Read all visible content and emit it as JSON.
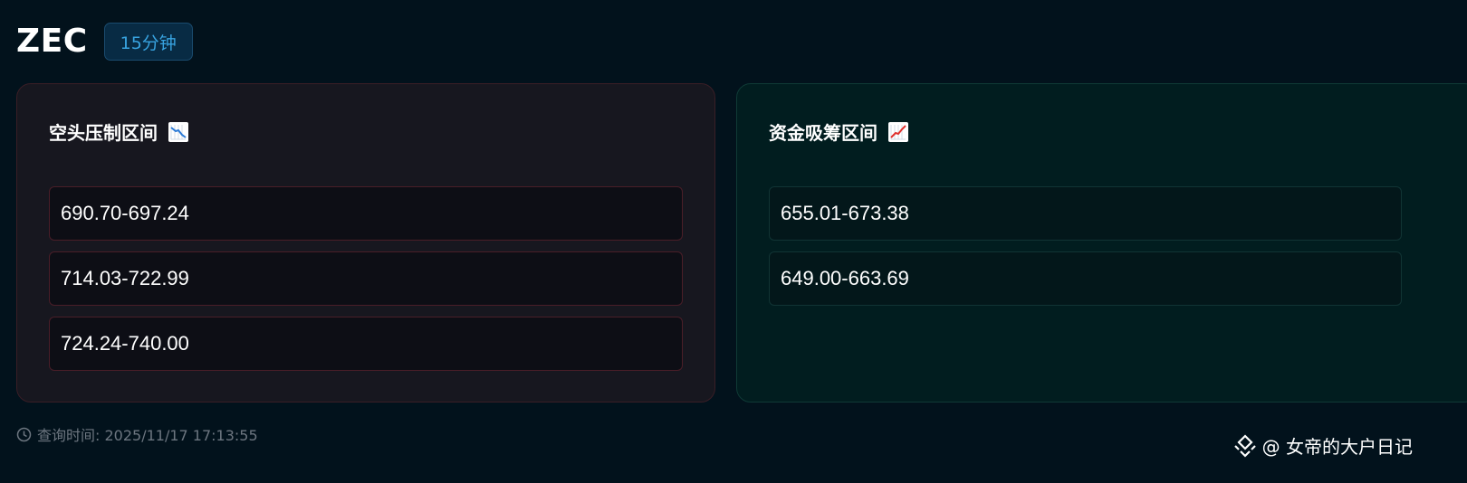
{
  "header": {
    "symbol": "ZEC",
    "timeframe": "15分钟"
  },
  "short_panel": {
    "title": "空头压制区间",
    "icon": "chart-decreasing-icon",
    "ranges": [
      "690.70-697.24",
      "714.03-722.99",
      "724.24-740.00"
    ]
  },
  "long_panel": {
    "title": "资金吸筹区间",
    "icon": "chart-increasing-icon",
    "ranges": [
      "655.01-673.38",
      "649.00-663.69"
    ]
  },
  "footer": {
    "query_time": "查询时间: 2025/11/17 17:13:55",
    "watermark": "@ 女帝的大户日记"
  },
  "colors": {
    "background": "#02121c",
    "badge_text": "#38a3e0",
    "short_accent": "#4a1e28",
    "long_accent": "#113434"
  }
}
